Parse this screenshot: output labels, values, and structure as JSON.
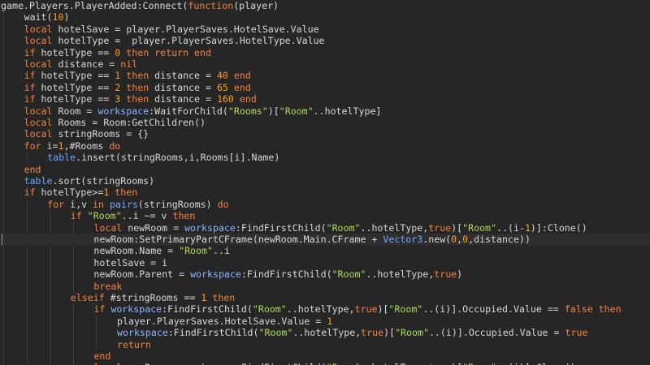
{
  "editor": {
    "language": "Lua",
    "current_line": 20,
    "colors": {
      "background": "#262626",
      "current_line": "#2e2e2e",
      "text": "#d8d8d8",
      "keyword": "#f4823f",
      "number": "#ff9f1c",
      "string": "#aadc5a",
      "global": "#8ab4ff",
      "builtin": "#6fa6ff"
    },
    "lines": [
      {
        "indent": 0,
        "tokens": [
          [
            "pl",
            "game.Players.PlayerAdded:Connect("
          ],
          [
            "kw",
            "function"
          ],
          [
            "pl",
            "(player)"
          ]
        ]
      },
      {
        "indent": 1,
        "tokens": [
          [
            "pl",
            "wait("
          ],
          [
            "num",
            "10"
          ],
          [
            "pl",
            ")"
          ]
        ]
      },
      {
        "indent": 1,
        "tokens": [
          [
            "kw",
            "local"
          ],
          [
            "pl",
            " hotelSave = player.PlayerSaves.HotelSave.Value"
          ]
        ]
      },
      {
        "indent": 1,
        "tokens": [
          [
            "kw",
            "local"
          ],
          [
            "pl",
            " hotelType =  player.PlayerSaves.HotelType.Value"
          ]
        ]
      },
      {
        "indent": 1,
        "tokens": [
          [
            "kw",
            "if"
          ],
          [
            "pl",
            " hotelType == "
          ],
          [
            "num",
            "0"
          ],
          [
            "pl",
            " "
          ],
          [
            "kw",
            "then"
          ],
          [
            "pl",
            " "
          ],
          [
            "kw",
            "return"
          ],
          [
            "pl",
            " "
          ],
          [
            "kw",
            "end"
          ]
        ]
      },
      {
        "indent": 1,
        "tokens": [
          [
            "kw",
            "local"
          ],
          [
            "pl",
            " distance = "
          ],
          [
            "kw",
            "nil"
          ]
        ]
      },
      {
        "indent": 1,
        "tokens": [
          [
            "kw",
            "if"
          ],
          [
            "pl",
            " hotelType == "
          ],
          [
            "num",
            "1"
          ],
          [
            "pl",
            " "
          ],
          [
            "kw",
            "then"
          ],
          [
            "pl",
            " distance = "
          ],
          [
            "num",
            "40"
          ],
          [
            "pl",
            " "
          ],
          [
            "kw",
            "end"
          ]
        ]
      },
      {
        "indent": 1,
        "tokens": [
          [
            "kw",
            "if"
          ],
          [
            "pl",
            " hotelType == "
          ],
          [
            "num",
            "2"
          ],
          [
            "pl",
            " "
          ],
          [
            "kw",
            "then"
          ],
          [
            "pl",
            " distance = "
          ],
          [
            "num",
            "65"
          ],
          [
            "pl",
            " "
          ],
          [
            "kw",
            "end"
          ]
        ]
      },
      {
        "indent": 1,
        "tokens": [
          [
            "kw",
            "if"
          ],
          [
            "pl",
            " hotelType == "
          ],
          [
            "num",
            "3"
          ],
          [
            "pl",
            " "
          ],
          [
            "kw",
            "then"
          ],
          [
            "pl",
            " distance = "
          ],
          [
            "num",
            "160"
          ],
          [
            "pl",
            " "
          ],
          [
            "kw",
            "end"
          ]
        ]
      },
      {
        "indent": 1,
        "tokens": [
          [
            "kw",
            "local"
          ],
          [
            "pl",
            " Room = "
          ],
          [
            "gl",
            "workspace"
          ],
          [
            "pl",
            ":WaitForChild("
          ],
          [
            "str",
            "\"Rooms\""
          ],
          [
            "pl",
            ")["
          ],
          [
            "str",
            "\"Room\""
          ],
          [
            "pl",
            "..hotelType]"
          ]
        ]
      },
      {
        "indent": 1,
        "tokens": [
          [
            "kw",
            "local"
          ],
          [
            "pl",
            " Rooms = Room:GetChildren()"
          ]
        ]
      },
      {
        "indent": 1,
        "tokens": [
          [
            "kw",
            "local"
          ],
          [
            "pl",
            " stringRooms = {}"
          ]
        ]
      },
      {
        "indent": 1,
        "tokens": [
          [
            "kw",
            "for"
          ],
          [
            "pl",
            " i="
          ],
          [
            "num",
            "1"
          ],
          [
            "pl",
            ",#Rooms "
          ],
          [
            "kw",
            "do"
          ]
        ]
      },
      {
        "indent": 2,
        "tokens": [
          [
            "bi",
            "table"
          ],
          [
            "pl",
            ".insert(stringRooms,i,Rooms[i].Name)"
          ]
        ]
      },
      {
        "indent": 1,
        "tokens": [
          [
            "kw",
            "end"
          ]
        ]
      },
      {
        "indent": 1,
        "tokens": [
          [
            "bi",
            "table"
          ],
          [
            "pl",
            ".sort(stringRooms)"
          ]
        ]
      },
      {
        "indent": 1,
        "tokens": [
          [
            "kw",
            "if"
          ],
          [
            "pl",
            " hotelType>="
          ],
          [
            "num",
            "1"
          ],
          [
            "pl",
            " "
          ],
          [
            "kw",
            "then"
          ]
        ]
      },
      {
        "indent": 2,
        "tokens": [
          [
            "kw",
            "for"
          ],
          [
            "pl",
            " i,v "
          ],
          [
            "kw",
            "in"
          ],
          [
            "pl",
            " "
          ],
          [
            "bi",
            "pairs"
          ],
          [
            "pl",
            "(stringRooms) "
          ],
          [
            "kw",
            "do"
          ]
        ]
      },
      {
        "indent": 3,
        "tokens": [
          [
            "kw",
            "if"
          ],
          [
            "pl",
            " "
          ],
          [
            "str",
            "\"Room\""
          ],
          [
            "pl",
            "..i ~= v "
          ],
          [
            "kw",
            "then"
          ]
        ]
      },
      {
        "indent": 4,
        "tokens": [
          [
            "kw",
            "local"
          ],
          [
            "pl",
            " newRoom = "
          ],
          [
            "gl",
            "workspace"
          ],
          [
            "pl",
            ":FindFirstChild("
          ],
          [
            "str",
            "\"Room\""
          ],
          [
            "pl",
            "..hotelType,"
          ],
          [
            "kw",
            "true"
          ],
          [
            "pl",
            ")["
          ],
          [
            "str",
            "\"Room\""
          ],
          [
            "pl",
            "..(i-"
          ],
          [
            "num",
            "1"
          ],
          [
            "pl",
            ")]:Clone()"
          ]
        ]
      },
      {
        "indent": 4,
        "tokens": [
          [
            "pl",
            "newRoom:SetPrimaryPartCFrame(newRoom.Main.CFrame + "
          ],
          [
            "bi",
            "Vector3"
          ],
          [
            "pl",
            ".new("
          ],
          [
            "num",
            "0"
          ],
          [
            "pl",
            ","
          ],
          [
            "num",
            "0"
          ],
          [
            "pl",
            ",distance))"
          ]
        ]
      },
      {
        "indent": 4,
        "tokens": [
          [
            "pl",
            "newRoom.Name = "
          ],
          [
            "str",
            "\"Room\""
          ],
          [
            "pl",
            "..i"
          ]
        ]
      },
      {
        "indent": 4,
        "tokens": [
          [
            "pl",
            "hotelSave = i"
          ]
        ]
      },
      {
        "indent": 4,
        "tokens": [
          [
            "pl",
            "newRoom.Parent = "
          ],
          [
            "gl",
            "workspace"
          ],
          [
            "pl",
            ":FindFirstChild("
          ],
          [
            "str",
            "\"Room\""
          ],
          [
            "pl",
            "..hotelType,"
          ],
          [
            "kw",
            "true"
          ],
          [
            "pl",
            ")"
          ]
        ]
      },
      {
        "indent": 4,
        "tokens": [
          [
            "kw",
            "break"
          ]
        ]
      },
      {
        "indent": 3,
        "tokens": [
          [
            "kw",
            "elseif"
          ],
          [
            "pl",
            " #stringRooms == "
          ],
          [
            "num",
            "1"
          ],
          [
            "pl",
            " "
          ],
          [
            "kw",
            "then"
          ]
        ]
      },
      {
        "indent": 4,
        "tokens": [
          [
            "kw",
            "if"
          ],
          [
            "pl",
            " "
          ],
          [
            "gl",
            "workspace"
          ],
          [
            "pl",
            ":FindFirstChild("
          ],
          [
            "str",
            "\"Room\""
          ],
          [
            "pl",
            "..hotelType,"
          ],
          [
            "kw",
            "true"
          ],
          [
            "pl",
            ")["
          ],
          [
            "str",
            "\"Room\""
          ],
          [
            "pl",
            "..(i)].Occupied.Value == "
          ],
          [
            "kw",
            "false"
          ],
          [
            "pl",
            " "
          ],
          [
            "kw",
            "then"
          ]
        ]
      },
      {
        "indent": 5,
        "tokens": [
          [
            "pl",
            "player.PlayerSaves.HotelSave.Value = "
          ],
          [
            "num",
            "1"
          ]
        ]
      },
      {
        "indent": 5,
        "tokens": [
          [
            "gl",
            "workspace"
          ],
          [
            "pl",
            ":FindFirstChild("
          ],
          [
            "str",
            "\"Room\""
          ],
          [
            "pl",
            "..hotelType,"
          ],
          [
            "kw",
            "true"
          ],
          [
            "pl",
            ")["
          ],
          [
            "str",
            "\"Room\""
          ],
          [
            "pl",
            "..(i)].Occupied.Value = "
          ],
          [
            "kw",
            "true"
          ]
        ]
      },
      {
        "indent": 5,
        "tokens": [
          [
            "kw",
            "return"
          ]
        ]
      },
      {
        "indent": 4,
        "tokens": [
          [
            "kw",
            "end"
          ]
        ]
      },
      {
        "indent": 4,
        "tokens": [
          [
            "kw",
            "local"
          ],
          [
            "pl",
            " newRoom = "
          ],
          [
            "gl",
            "workspace"
          ],
          [
            "pl",
            ":FindFirstChild("
          ],
          [
            "str",
            "\"Room\""
          ],
          [
            "pl",
            "..hotelType,"
          ],
          [
            "kw",
            "true"
          ],
          [
            "pl",
            ")["
          ],
          [
            "str",
            "\"Room\""
          ],
          [
            "pl",
            "..(i)]:Clone()"
          ]
        ]
      }
    ]
  }
}
